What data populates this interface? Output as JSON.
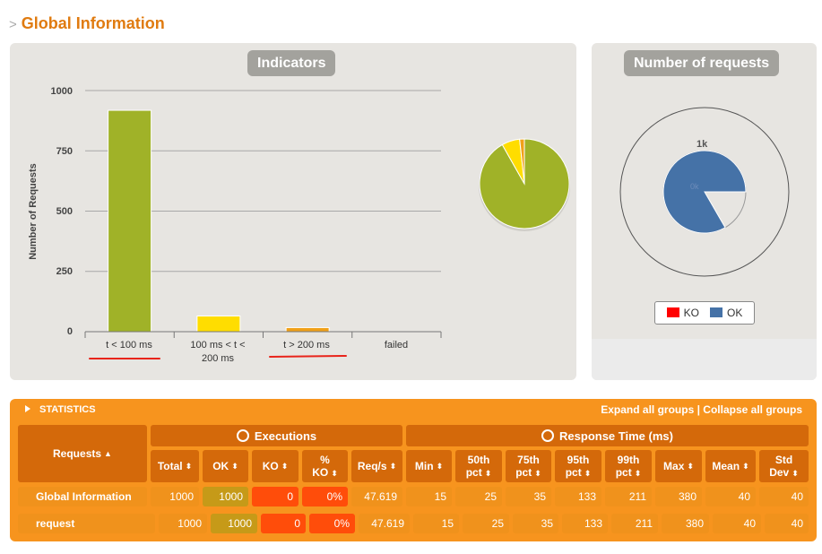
{
  "page": {
    "title": "Global Information"
  },
  "indicators": {
    "title": "Indicators",
    "ylabel": "Number of Requests",
    "yticks": [
      "1000",
      "750",
      "500",
      "250",
      "0"
    ],
    "categories": [
      "t < 100 ms",
      "100 ms < t <",
      "200 ms",
      "t > 200 ms",
      "failed"
    ]
  },
  "requests_panel": {
    "title": "Number of requests",
    "tick_label": "1k",
    "inner_label": "0k",
    "legend": [
      {
        "label": "KO",
        "color": "#ff0000"
      },
      {
        "label": "OK",
        "color": "#4572a7"
      }
    ]
  },
  "chart_data": [
    {
      "type": "bar",
      "title": "Indicators",
      "ylabel": "Number of Requests",
      "categories": [
        "t < 100 ms",
        "100 ms < t < 200 ms",
        "t > 200 ms",
        "failed"
      ],
      "values": [
        918,
        65,
        17,
        0
      ],
      "colors": [
        "#a0b228",
        "#ffdd00",
        "#f0a018",
        "#ff0000"
      ],
      "ylim": [
        0,
        1000
      ],
      "grid": true
    },
    {
      "type": "pie",
      "categories": [
        "t < 100 ms",
        "100 ms < t < 200 ms",
        "t > 200 ms"
      ],
      "values": [
        918,
        65,
        17
      ],
      "colors": [
        "#a0b228",
        "#ffdd00",
        "#f0a018"
      ]
    },
    {
      "type": "pie",
      "title": "Number of requests",
      "categories": [
        "KO",
        "OK"
      ],
      "values": [
        0,
        1000
      ],
      "colors": [
        "#ff0000",
        "#4572a7"
      ]
    }
  ],
  "stats": {
    "title": "STATISTICS",
    "expand": "Expand all groups",
    "separator": " | ",
    "collapse": "Collapse all groups",
    "group_exec": "Executions",
    "group_resp": "Response Time (ms)",
    "headers": {
      "requests": "Requests",
      "total": "Total",
      "ok": "OK",
      "ko": "KO",
      "pct_ko_1": "%",
      "pct_ko_2": "KO",
      "reqs": "Req/s",
      "min": "Min",
      "p50_1": "50th",
      "p50_2": "pct",
      "p75_1": "75th",
      "p75_2": "pct",
      "p95_1": "95th",
      "p95_2": "pct",
      "p99_1": "99th",
      "p99_2": "pct",
      "max": "Max",
      "mean": "Mean",
      "std_1": "Std",
      "std_2": "Dev"
    },
    "rows": [
      {
        "name": "Global Information",
        "total": "1000",
        "ok": "1000",
        "ko": "0",
        "pct_ko": "0%",
        "reqs": "47.619",
        "min": "15",
        "p50": "25",
        "p75": "35",
        "p95": "133",
        "p99": "211",
        "max": "380",
        "mean": "40",
        "std": "40"
      },
      {
        "name": "request",
        "total": "1000",
        "ok": "1000",
        "ko": "0",
        "pct_ko": "0%",
        "reqs": "47.619",
        "min": "15",
        "p50": "25",
        "p75": "35",
        "p95": "133",
        "p99": "211",
        "max": "380",
        "mean": "40",
        "std": "40"
      }
    ]
  }
}
